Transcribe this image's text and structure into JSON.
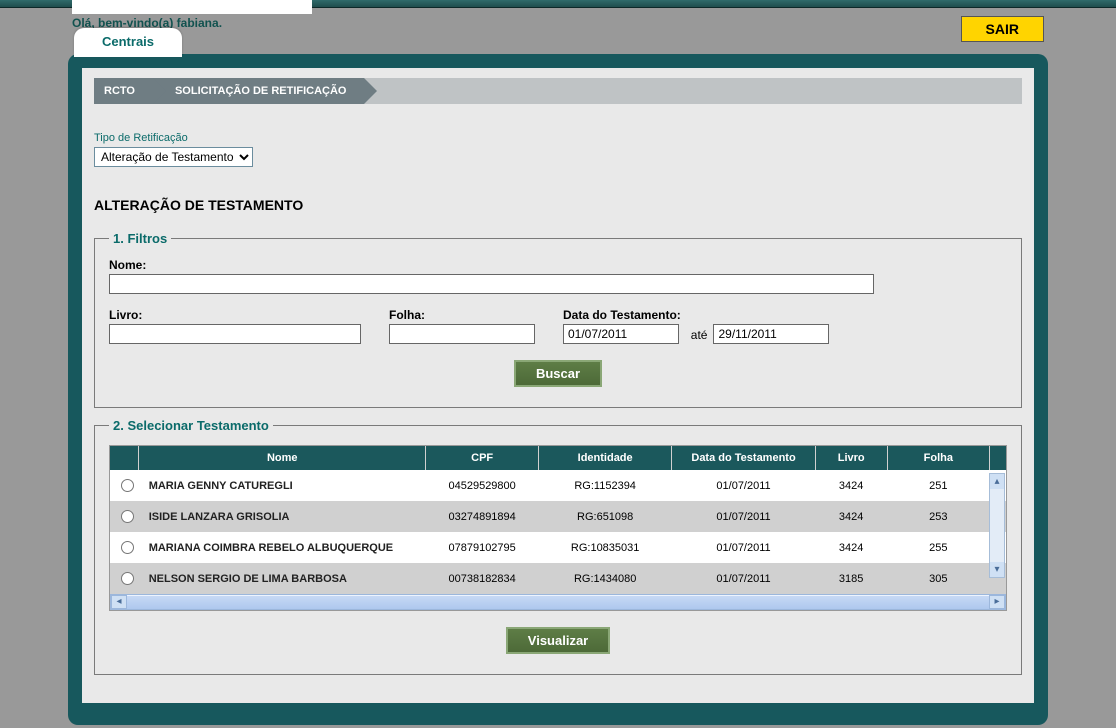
{
  "welcome_text": "Olá, bem-vindo(a) fabiana.",
  "sair_label": "SAIR",
  "tab_label": "Centrais",
  "breadcrumb": {
    "item1": "RCTO",
    "item2": "SOLICITAÇÃO DE RETIFICAÇÃO"
  },
  "tipo_label": "Tipo de Retificação",
  "tipo_value": "Alteração de Testamento",
  "section_heading": "ALTERAÇÃO DE TESTAMENTO",
  "filtros": {
    "legend": "1. Filtros",
    "nome_label": "Nome:",
    "nome_value": "",
    "livro_label": "Livro:",
    "livro_value": "",
    "folha_label": "Folha:",
    "folha_value": "",
    "data_label": "Data do Testamento:",
    "data1_value": "01/07/2011",
    "ate_label": "até",
    "data2_value": "29/11/2011",
    "buscar_label": "Buscar"
  },
  "selecionar": {
    "legend": "2. Selecionar Testamento",
    "visualizar_label": "Visualizar",
    "headers": {
      "nome": "Nome",
      "cpf": "CPF",
      "identidade": "Identidade",
      "data": "Data do Testamento",
      "livro": "Livro",
      "folha": "Folha"
    },
    "rows": [
      {
        "nome": "MARIA GENNY CATUREGLI",
        "cpf": "04529529800",
        "identidade": "RG:1152394",
        "data": "01/07/2011",
        "livro": "3424",
        "folha": "251"
      },
      {
        "nome": "ISIDE LANZARA GRISOLIA",
        "cpf": "03274891894",
        "identidade": "RG:651098",
        "data": "01/07/2011",
        "livro": "3424",
        "folha": "253"
      },
      {
        "nome": "MARIANA COIMBRA REBELO ALBUQUERQUE",
        "cpf": "07879102795",
        "identidade": "RG:10835031",
        "data": "01/07/2011",
        "livro": "3424",
        "folha": "255"
      },
      {
        "nome": "NELSON SERGIO DE LIMA BARBOSA",
        "cpf": "00738182834",
        "identidade": "RG:1434080",
        "data": "01/07/2011",
        "livro": "3185",
        "folha": "305"
      }
    ]
  }
}
